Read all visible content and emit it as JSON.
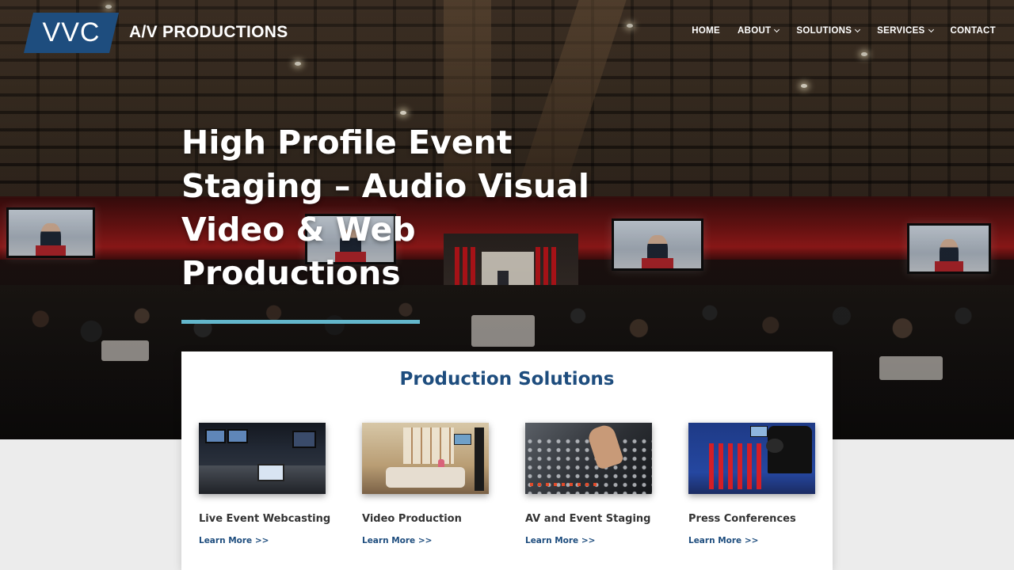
{
  "brand": {
    "logo_text": "VVC",
    "name": "A/V PRODUCTIONS",
    "color": "#1e4d7e"
  },
  "nav": {
    "items": [
      {
        "label": "HOME",
        "has_dropdown": false
      },
      {
        "label": "ABOUT",
        "has_dropdown": true
      },
      {
        "label": "SOLUTIONS",
        "has_dropdown": true
      },
      {
        "label": "SERVICES",
        "has_dropdown": true
      },
      {
        "label": "CONTACT",
        "has_dropdown": false
      }
    ]
  },
  "hero": {
    "title_lines": [
      "High Profile Event",
      "Staging – Audio Visual",
      "Video & Web",
      "Productions"
    ],
    "accent_color": "#63b7cc",
    "image": "conference-hall-photo"
  },
  "solutions": {
    "title": "Production Solutions",
    "items": [
      {
        "name": "Live Event Webcasting",
        "link": "Learn More >>",
        "image": "control-room-photo"
      },
      {
        "name": "Video Production",
        "link": "Learn More >>",
        "image": "studio-photo"
      },
      {
        "name": "AV and Event Staging",
        "link": "Learn More >>",
        "image": "audio-mixer-photo"
      },
      {
        "name": "Press Conferences",
        "link": "Learn More >>",
        "image": "press-conference-photo"
      }
    ]
  }
}
